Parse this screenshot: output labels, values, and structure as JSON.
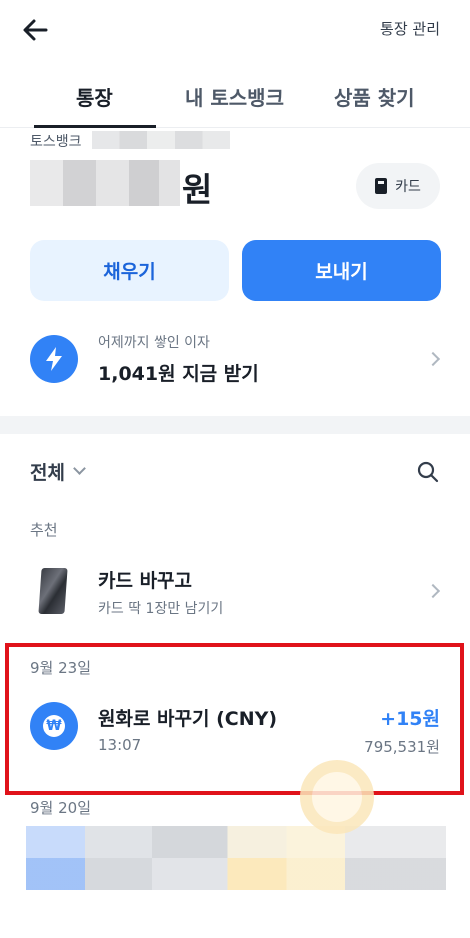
{
  "header": {
    "manage_label": "통장 관리"
  },
  "tabs": [
    {
      "label": "통장",
      "active": true
    },
    {
      "label": "내 토스뱅크",
      "active": false
    },
    {
      "label": "상품 찾기",
      "active": false
    }
  ],
  "account": {
    "bank_prefix": "토스뱅크",
    "balance_unit": "원",
    "card_chip_label": "카드"
  },
  "actions": {
    "fill_label": "채우기",
    "send_label": "보내기"
  },
  "interest": {
    "caption": "어제까지 쌓인 이자",
    "cta": "1,041원 지금 받기"
  },
  "filter": {
    "label": "전체"
  },
  "recommend": {
    "section": "추천",
    "title": "카드 바꾸고",
    "subtitle": "카드 딱 1장만 남기기"
  },
  "transactions": [
    {
      "date": "9월 23일",
      "title": "원화로 바꾸기 (CNY)",
      "time": "13:07",
      "amount": "+15원",
      "balance": "795,531원"
    }
  ],
  "next_date": "9월 20일",
  "colors": {
    "accent": "#3182f6",
    "highlight": "#e0121a",
    "soft_blue": "#e8f3ff"
  }
}
